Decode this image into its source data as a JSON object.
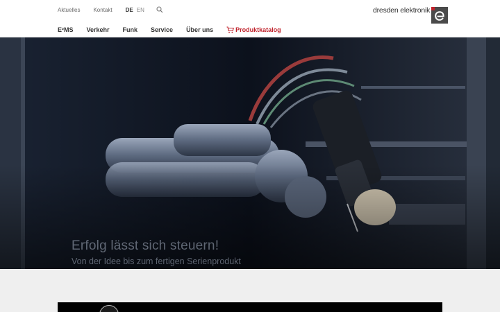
{
  "topbar": {
    "links": [
      "Aktuelles",
      "Kontakt"
    ],
    "lang_active": "DE",
    "lang_other": "EN"
  },
  "logo": {
    "text": "dresden elektronik"
  },
  "mainnav": {
    "items": [
      "E²MS",
      "Verkehr",
      "Funk",
      "Service",
      "Über uns"
    ],
    "catalog": "Produktkatalog"
  },
  "hero": {
    "title": "Erfolg lässt sich steuern!",
    "subtitle": "Von der Idee bis zum fertigen Serienprodukt"
  },
  "colors": {
    "accent": "#c0232c",
    "text": "#333333",
    "section_bg": "#efefef"
  }
}
